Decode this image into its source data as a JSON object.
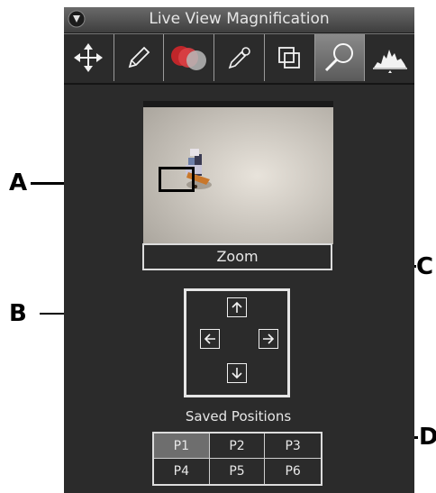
{
  "window": {
    "title": "Live View Magnification"
  },
  "toolbar": {
    "tools": [
      {
        "name": "move-tool",
        "active": false
      },
      {
        "name": "pencil-tool",
        "active": false
      },
      {
        "name": "color-tool",
        "active": false
      },
      {
        "name": "eyedropper-tool",
        "active": false
      },
      {
        "name": "overlay-tool",
        "active": false
      },
      {
        "name": "magnify-tool",
        "active": true
      },
      {
        "name": "histogram-tool",
        "active": false
      }
    ]
  },
  "zoom": {
    "label": "Zoom"
  },
  "saved_positions": {
    "label": "Saved Positions",
    "slots": [
      "P1",
      "P2",
      "P3",
      "P4",
      "P5",
      "P6"
    ],
    "selected": "P1"
  },
  "callouts": {
    "a": "A",
    "b": "B",
    "c": "C",
    "d": "D"
  }
}
